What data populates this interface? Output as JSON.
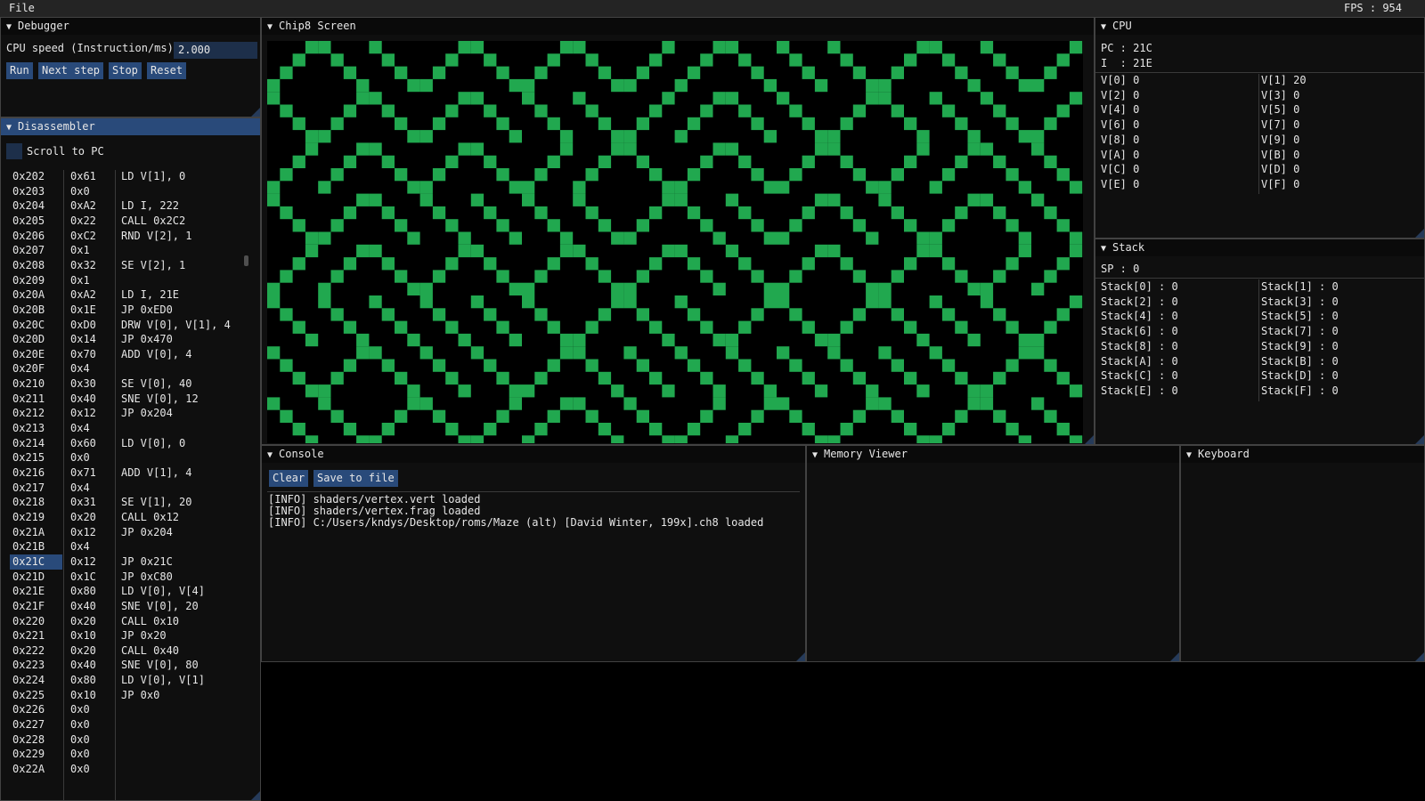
{
  "menubar": {
    "file": "File",
    "fps": "FPS : 954"
  },
  "debugger": {
    "title": "Debugger",
    "speed_label": "CPU speed (Instruction/ms)",
    "speed_value": "2.000",
    "buttons": {
      "run": "Run",
      "next": "Next step",
      "stop": "Stop",
      "reset": "Reset"
    }
  },
  "disassembler": {
    "title": "Disassembler",
    "scroll_to_pc": "Scroll to PC",
    "highlighted": "0x21C",
    "rows": [
      {
        "addr": "0x202",
        "op": "0x61",
        "ins": "LD V[1], 0"
      },
      {
        "addr": "0x203",
        "op": "0x0",
        "ins": ""
      },
      {
        "addr": "0x204",
        "op": "0xA2",
        "ins": "LD I, 222"
      },
      {
        "addr": "0x205",
        "op": "0x22",
        "ins": "CALL 0x2C2"
      },
      {
        "addr": "0x206",
        "op": "0xC2",
        "ins": "RND V[2], 1"
      },
      {
        "addr": "0x207",
        "op": "0x1",
        "ins": ""
      },
      {
        "addr": "0x208",
        "op": "0x32",
        "ins": "SE V[2], 1"
      },
      {
        "addr": "0x209",
        "op": "0x1",
        "ins": ""
      },
      {
        "addr": "0x20A",
        "op": "0xA2",
        "ins": "LD I, 21E"
      },
      {
        "addr": "0x20B",
        "op": "0x1E",
        "ins": "JP 0xED0"
      },
      {
        "addr": "0x20C",
        "op": "0xD0",
        "ins": "DRW V[0], V[1], 4"
      },
      {
        "addr": "0x20D",
        "op": "0x14",
        "ins": "JP 0x470"
      },
      {
        "addr": "0x20E",
        "op": "0x70",
        "ins": "ADD V[0], 4"
      },
      {
        "addr": "0x20F",
        "op": "0x4",
        "ins": ""
      },
      {
        "addr": "0x210",
        "op": "0x30",
        "ins": "SE V[0], 40"
      },
      {
        "addr": "0x211",
        "op": "0x40",
        "ins": "SNE V[0], 12"
      },
      {
        "addr": "0x212",
        "op": "0x12",
        "ins": "JP 0x204"
      },
      {
        "addr": "0x213",
        "op": "0x4",
        "ins": ""
      },
      {
        "addr": "0x214",
        "op": "0x60",
        "ins": "LD V[0], 0"
      },
      {
        "addr": "0x215",
        "op": "0x0",
        "ins": ""
      },
      {
        "addr": "0x216",
        "op": "0x71",
        "ins": "ADD V[1], 4"
      },
      {
        "addr": "0x217",
        "op": "0x4",
        "ins": ""
      },
      {
        "addr": "0x218",
        "op": "0x31",
        "ins": "SE V[1], 20"
      },
      {
        "addr": "0x219",
        "op": "0x20",
        "ins": "CALL 0x12"
      },
      {
        "addr": "0x21A",
        "op": "0x12",
        "ins": "JP 0x204"
      },
      {
        "addr": "0x21B",
        "op": "0x4",
        "ins": ""
      },
      {
        "addr": "0x21C",
        "op": "0x12",
        "ins": "JP 0x21C"
      },
      {
        "addr": "0x21D",
        "op": "0x1C",
        "ins": "JP 0xC80"
      },
      {
        "addr": "0x21E",
        "op": "0x80",
        "ins": "LD V[0], V[4]"
      },
      {
        "addr": "0x21F",
        "op": "0x40",
        "ins": "SNE V[0], 20"
      },
      {
        "addr": "0x220",
        "op": "0x20",
        "ins": "CALL 0x10"
      },
      {
        "addr": "0x221",
        "op": "0x10",
        "ins": "JP 0x20"
      },
      {
        "addr": "0x222",
        "op": "0x20",
        "ins": "CALL 0x40"
      },
      {
        "addr": "0x223",
        "op": "0x40",
        "ins": "SNE V[0], 80"
      },
      {
        "addr": "0x224",
        "op": "0x80",
        "ins": "LD V[0], V[1]"
      },
      {
        "addr": "0x225",
        "op": "0x10",
        "ins": "JP 0x0"
      },
      {
        "addr": "0x226",
        "op": "0x0",
        "ins": ""
      },
      {
        "addr": "0x227",
        "op": "0x0",
        "ins": ""
      },
      {
        "addr": "0x228",
        "op": "0x0",
        "ins": ""
      },
      {
        "addr": "0x229",
        "op": "0x0",
        "ins": ""
      },
      {
        "addr": "0x22A",
        "op": "0x0",
        "ins": ""
      }
    ]
  },
  "screen": {
    "title": "Chip8 Screen",
    "on_color": "#21a84f",
    "off_color": "#000000",
    "pattern": [
      "/\\\\/\\/\\//\\\\\\/\\\\/\\/\\\\\\\\//\\/\\/\\\\\\//\\/\\/\\/\\/\\\\\\/\\\\\\/\\\\//\\\\/\\\\\\\\/\\///\\\\/",
      "\\/\\/\\\\\\//\\\\/\\\\\\/\\/\\\\/\\\\//\\\\//\\/\\/\\\\\\\\\\/\\\\\\/\\\\\\//\\\\/\\/\\/\\/\\\\\\/\\\\\\",
      "//\\/\\//\\/\\/\\//\\\\\\\\/\\/\\\\/\\/\\///\\/\\/\\\\\\/\\\\\\\\\\/\\/\\\\\\\\/\\\\/\\/\\/\\///\\/\\",
      "\\/\\\\\\\\\\/\\\\/\\\\/\\\\//\\/\\\\\\/\\\\/\\/\\///\\\\\\/\\/\\\\//\\\\\\/\\/\\\\/\\\\/\\\\\\/\\\\\\\\",
      "//\\/\\/\\/\\\\/\\/\\//\\\\/\\\\/\\\\/\\\\//\\\\\\\\/\\\\/\\\\\\/\\/\\\\\\/\\\\\\\\\\//\\\\\\\\/\\/\\/\\",
      "\\\\\\\\\\\\/\\\\/\\/\\\\\\/\\\\//\\\\\\//\\/\\/\\\\/\\\\\\\\//\\\\\\\\\\//\\\\\\\\\\\\/\\\\\\\\\\\\\\/\\/\\",
      "\\/\\\\\\/\\\\\\\\\\\\\\\\/\\/\\/\\/\\/\\/\\/\\/\\/\\\\\\\\\\/\\/\\\\/\\\\\\\\\\\\/\\\\\\/\\\\\\\\//\\/",
      "\\\\/\\//\\\\//\\/\\/\\\\\\/\\/\\\\\\\\\\\\/\\\\\\\\/\\\\/\\/\\\\\\\\/\\\\/\\\\\\\\\\//\\\\/\\\\/\\\\/\\\\\\"
    ]
  },
  "cpu": {
    "title": "CPU",
    "pc": "PC : 21C",
    "i": "I  : 21E",
    "regs": [
      "V[0] 0",
      "V[1] 20",
      "V[2] 0",
      "V[3] 0",
      "V[4] 0",
      "V[5] 0",
      "V[6] 0",
      "V[7] 0",
      "V[8] 0",
      "V[9] 0",
      "V[A] 0",
      "V[B] 0",
      "V[C] 0",
      "V[D] 0",
      "V[E] 0",
      "V[F] 0"
    ]
  },
  "stack": {
    "title": "Stack",
    "sp": "SP : 0",
    "entries": [
      "Stack[0] : 0",
      "Stack[1] : 0",
      "Stack[2] : 0",
      "Stack[3] : 0",
      "Stack[4] : 0",
      "Stack[5] : 0",
      "Stack[6] : 0",
      "Stack[7] : 0",
      "Stack[8] : 0",
      "Stack[9] : 0",
      "Stack[A] : 0",
      "Stack[B] : 0",
      "Stack[C] : 0",
      "Stack[D] : 0",
      "Stack[E] : 0",
      "Stack[F] : 0"
    ]
  },
  "console": {
    "title": "Console",
    "clear": "Clear",
    "save": "Save to file",
    "lines": [
      "[INFO] shaders/vertex.vert loaded",
      "[INFO] shaders/vertex.frag loaded",
      "[INFO] C:/Users/kndys/Desktop/roms/Maze (alt) [David Winter, 199x].ch8 loaded"
    ]
  },
  "memory": {
    "title": "Memory Viewer"
  },
  "keyboard": {
    "title": "Keyboard"
  }
}
